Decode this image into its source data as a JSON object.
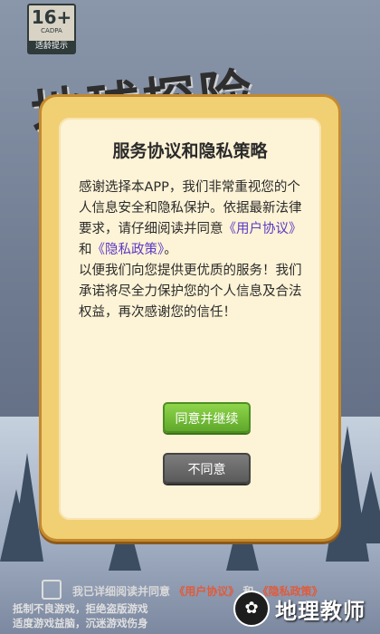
{
  "age_rating": {
    "number": "16+",
    "org": "CADPA",
    "tip": "适龄提示"
  },
  "game_title": "地球探险",
  "dialog": {
    "title": "服务协议和隐私策略",
    "body_intro": "感谢选择本APP，我们非常重视您的个人信息安全和隐私保护。依据最新法律要求，请仔细阅读并同意",
    "user_agreement_link": "《用户协议》",
    "and_word": "和",
    "privacy_policy_link": "《隐私政策》",
    "period": "。",
    "body_outro": "以便我们向您提供更优质的服务！我们承诺将尽全力保护您的个人信息及合法权益，再次感谢您的信任！",
    "agree_button": "同意并继续",
    "decline_button": "不同意"
  },
  "consent": {
    "text": "我已详细阅读并同意",
    "link1": "《用户协议》",
    "and_word": "和",
    "link2": "《隐私政策》"
  },
  "health_notice": {
    "line1": "抵制不良游戏，拒绝盗版游戏",
    "line2": "适度游戏益脑，沉迷游戏伤身"
  },
  "watermark": {
    "logo": "✿",
    "text": "地理教师"
  },
  "colors": {
    "link": "#5a39c6",
    "agree": "#6cb42f",
    "decline": "#666666",
    "frame": "#f1cf73"
  }
}
